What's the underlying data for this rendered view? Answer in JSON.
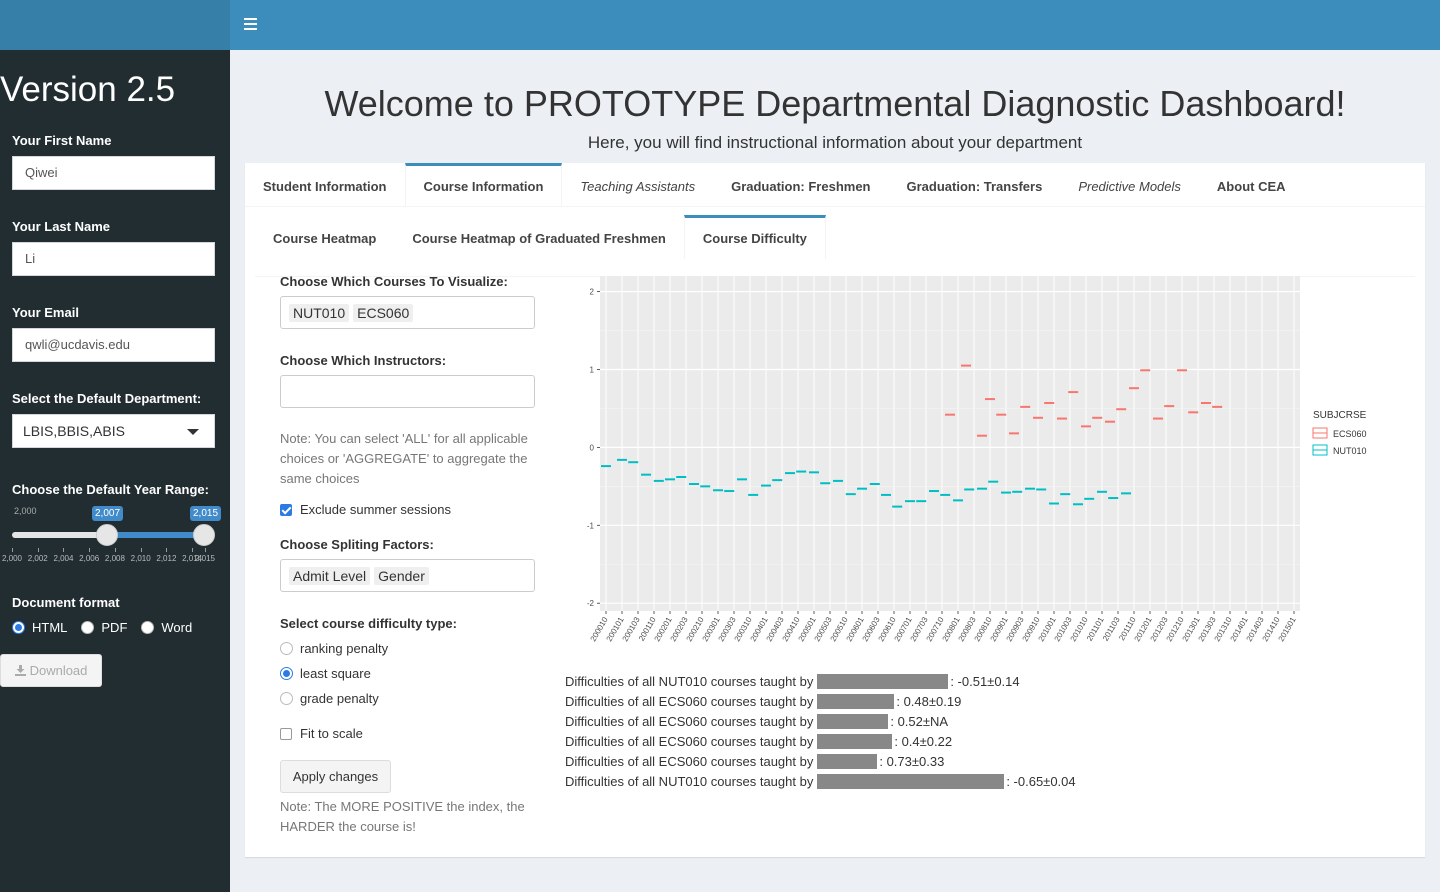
{
  "sidebar": {
    "version": "Version 2.5",
    "first_name_label": "Your First Name",
    "first_name": "Qiwei",
    "last_name_label": "Your Last Name",
    "last_name": "Li",
    "email_label": "Your Email",
    "email": "qwli@ucdavis.edu",
    "dept_label": "Select the Default Department:",
    "dept_value": "LBIS,BBIS,ABIS",
    "year_label": "Choose the Default Year Range:",
    "year_min": "2,000",
    "year_max": "2,015",
    "year_from": "2,007",
    "year_to": "2,015",
    "year_ticks": [
      "2,000",
      "2,002",
      "2,004",
      "2,006",
      "2,008",
      "2,010",
      "2,012",
      "2,014",
      "2,015"
    ],
    "format_label": "Document format",
    "formats": [
      "HTML",
      "PDF",
      "Word"
    ],
    "selected_format": "HTML",
    "download_label": "Download"
  },
  "header": {
    "title": "Welcome to PROTOTYPE Departmental Diagnostic Dashboard!",
    "subtitle": "Here, you will find instructional information about your department"
  },
  "tabs": [
    "Student Information",
    "Course Information",
    "Teaching Assistants",
    "Graduation: Freshmen",
    "Graduation: Transfers",
    "Predictive Models",
    "About CEA"
  ],
  "active_tab": "Course Information",
  "subtabs": [
    "Course Heatmap",
    "Course Heatmap of Graduated Freshmen",
    "Course Difficulty"
  ],
  "active_subtab": "Course Difficulty",
  "form": {
    "courses_label": "Choose Which Courses To Visualize:",
    "courses": [
      "NUT010",
      "ECS060"
    ],
    "instructors_label": "Choose Which Instructors:",
    "note1": "Note: You can select 'ALL' for all applicable choices or 'AGGREGATE' to aggregate the same choices",
    "exclude_summer": "Exclude summer sessions",
    "split_label": "Choose Spliting Factors:",
    "split_factors": [
      "Admit Level",
      "Gender"
    ],
    "difficulty_label": "Select course difficulty type:",
    "difficulty_types": [
      "ranking penalty",
      "least square",
      "grade penalty"
    ],
    "selected_difficulty": "least square",
    "fit_scale": "Fit to scale",
    "apply_label": "Apply changes",
    "note2": "Note: The MORE POSITIVE the index, the HARDER the course is!"
  },
  "chart_data": {
    "type": "scatter",
    "xlabel": "",
    "ylabel": "",
    "ylim": [
      -2.1,
      2.2
    ],
    "yticks": [
      2,
      1,
      0,
      -1,
      -2
    ],
    "x": [
      "200010",
      "200101",
      "200103",
      "200110",
      "200201",
      "200203",
      "200210",
      "200301",
      "200303",
      "200310",
      "200401",
      "200403",
      "200410",
      "200501",
      "200503",
      "200510",
      "200601",
      "200603",
      "200610",
      "200701",
      "200703",
      "200710",
      "200801",
      "200803",
      "200810",
      "200901",
      "200903",
      "200910",
      "201001",
      "201003",
      "201010",
      "201101",
      "201103",
      "201110",
      "201201",
      "201203",
      "201210",
      "201301",
      "201303",
      "201310",
      "201401",
      "201403",
      "201410",
      "201501"
    ],
    "legend_title": "SUBJCRSE",
    "series": [
      {
        "name": "ECS060",
        "color": "#f8766d",
        "points": [
          [
            21.5,
            0.42
          ],
          [
            22.5,
            1.05
          ],
          [
            23.5,
            0.15
          ],
          [
            24.0,
            0.62
          ],
          [
            24.7,
            0.42
          ],
          [
            25.5,
            0.18
          ],
          [
            26.2,
            0.52
          ],
          [
            27.0,
            0.38
          ],
          [
            27.7,
            0.57
          ],
          [
            28.5,
            0.37
          ],
          [
            29.2,
            0.71
          ],
          [
            30.0,
            0.27
          ],
          [
            30.7,
            0.38
          ],
          [
            31.5,
            0.33
          ],
          [
            32.2,
            0.49
          ],
          [
            33.0,
            0.76
          ],
          [
            33.7,
            0.99
          ],
          [
            34.5,
            0.37
          ],
          [
            35.2,
            0.53
          ],
          [
            36.0,
            0.99
          ],
          [
            36.7,
            0.45
          ],
          [
            37.5,
            0.57
          ],
          [
            38.2,
            0.52
          ]
        ]
      },
      {
        "name": "NUT010",
        "color": "#00bfc4",
        "points": [
          [
            0,
            -0.24
          ],
          [
            1,
            -0.16
          ],
          [
            1.7,
            -0.19
          ],
          [
            2.5,
            -0.35
          ],
          [
            3.3,
            -0.43
          ],
          [
            4,
            -0.41
          ],
          [
            4.7,
            -0.38
          ],
          [
            5.5,
            -0.47
          ],
          [
            6.2,
            -0.5
          ],
          [
            7,
            -0.55
          ],
          [
            7.7,
            -0.56
          ],
          [
            8.5,
            -0.41
          ],
          [
            9.2,
            -0.61
          ],
          [
            10,
            -0.49
          ],
          [
            10.7,
            -0.42
          ],
          [
            11.5,
            -0.33
          ],
          [
            12.2,
            -0.31
          ],
          [
            13,
            -0.32
          ],
          [
            13.7,
            -0.46
          ],
          [
            14.5,
            -0.43
          ],
          [
            15.3,
            -0.6
          ],
          [
            16,
            -0.53
          ],
          [
            16.8,
            -0.47
          ],
          [
            17.5,
            -0.61
          ],
          [
            18.2,
            -0.76
          ],
          [
            19,
            -0.69
          ],
          [
            19.7,
            -0.69
          ],
          [
            20.5,
            -0.56
          ],
          [
            21.2,
            -0.61
          ],
          [
            22,
            -0.68
          ],
          [
            22.7,
            -0.54
          ],
          [
            23.5,
            -0.53
          ],
          [
            24.2,
            -0.44
          ],
          [
            25,
            -0.58
          ],
          [
            25.7,
            -0.57
          ],
          [
            26.5,
            -0.53
          ],
          [
            27.2,
            -0.54
          ],
          [
            28,
            -0.72
          ],
          [
            28.7,
            -0.6
          ],
          [
            29.5,
            -0.73
          ],
          [
            30.2,
            -0.66
          ],
          [
            31,
            -0.57
          ],
          [
            31.7,
            -0.65
          ],
          [
            32.5,
            -0.59
          ]
        ]
      }
    ]
  },
  "difficulties": [
    {
      "text": "Difficulties of all NUT010 courses taught by",
      "value": ": -0.51±0.14",
      "bar": 0.7
    },
    {
      "text": "Difficulties of all ECS060 courses taught by",
      "value": ": 0.48±0.19",
      "bar": 0.41
    },
    {
      "text": "Difficulties of all ECS060 courses taught by",
      "value": ": 0.52±NA",
      "bar": 0.38
    },
    {
      "text": "Difficulties of all ECS060 courses taught by",
      "value": ": 0.4±0.22",
      "bar": 0.4
    },
    {
      "text": "Difficulties of all ECS060 courses taught by",
      "value": ": 0.73±0.33",
      "bar": 0.32
    },
    {
      "text": "Difficulties of all NUT010 courses taught by",
      "value": ": -0.65±0.04",
      "bar": 1.0
    }
  ]
}
